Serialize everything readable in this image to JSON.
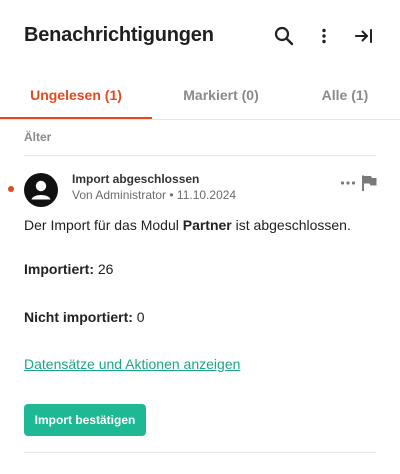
{
  "header": {
    "title": "Benachrichtigungen",
    "icons": [
      "search-icon",
      "more-vertical-icon",
      "collapse-panel-icon"
    ]
  },
  "tabs": [
    {
      "label": "Ungelesen (1)",
      "active": true
    },
    {
      "label": "Markiert (0)",
      "active": false
    },
    {
      "label": "Alle (1)",
      "active": false
    }
  ],
  "section": {
    "label": "Älter"
  },
  "notification": {
    "title": "Import abgeschlossen",
    "meta": "Von Administrator • 11.10.2024",
    "message_prefix": "Der Import für das Modul ",
    "message_module": "Partner",
    "message_suffix": " ist abgeschlossen.",
    "imported_label": "Importiert:",
    "imported_value": "26",
    "not_imported_label": "Nicht importiert:",
    "not_imported_value": "0",
    "link_label": "Datensätze und Aktionen anzeigen",
    "button_label": "Import bestätigen",
    "unread": true
  },
  "colors": {
    "accent": "#e4491d",
    "primary_button": "#1fb894",
    "link": "#1aa68a"
  }
}
